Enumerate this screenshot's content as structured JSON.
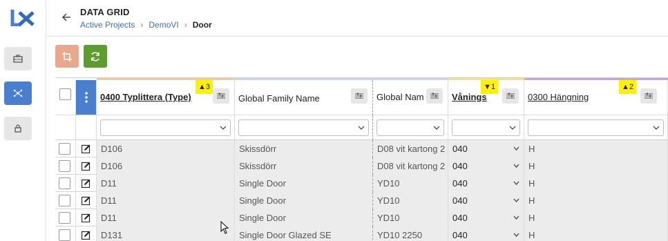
{
  "app": {
    "logo_text": "lx"
  },
  "rail": {
    "items": [
      {
        "name": "briefcase-icon",
        "active": false
      },
      {
        "name": "network-icon",
        "active": true
      },
      {
        "name": "lock-icon",
        "active": false
      }
    ]
  },
  "header": {
    "title": "DATA GRID",
    "breadcrumbs": [
      "Active Projects",
      "DemoVI",
      "Door"
    ]
  },
  "toolbar": {
    "buttons": [
      {
        "name": "crop-icon",
        "color": "#e9a88c"
      },
      {
        "name": "refresh-icon",
        "color": "#5f9c2f"
      }
    ]
  },
  "grid": {
    "columns": [
      {
        "label": "0400 Typlittera (Type)",
        "sort": "▲3",
        "color": "#f3c9a0"
      },
      {
        "label": "Global Family Name",
        "sort": "",
        "color": "#c7d7ee"
      },
      {
        "label": "Global Nam",
        "sort": "",
        "color": "#c7d7ee"
      },
      {
        "label": "Vånings",
        "sort": "▼1",
        "color": "#f3e28a"
      },
      {
        "label": "0300 Hängning",
        "sort": "▲2",
        "color": "#c8a6df"
      }
    ],
    "rows": [
      [
        "D106",
        "Skissdörr",
        "D08 vit kartong 2",
        "040",
        "H"
      ],
      [
        "D106",
        "Skissdörr",
        "D08 vit kartong 2",
        "040",
        "H"
      ],
      [
        "D11",
        "Single Door",
        "YD10",
        "040",
        "H"
      ],
      [
        "D11",
        "Single Door",
        "YD10",
        "040",
        "H"
      ],
      [
        "D11",
        "Single Door",
        "YD10",
        "040",
        "H"
      ],
      [
        "D131",
        "Single Door Glazed SE",
        "YD10 2250",
        "040",
        "H"
      ]
    ]
  },
  "colors": {
    "accent": "#4a7fd0",
    "sort_highlight": "#fff200"
  }
}
